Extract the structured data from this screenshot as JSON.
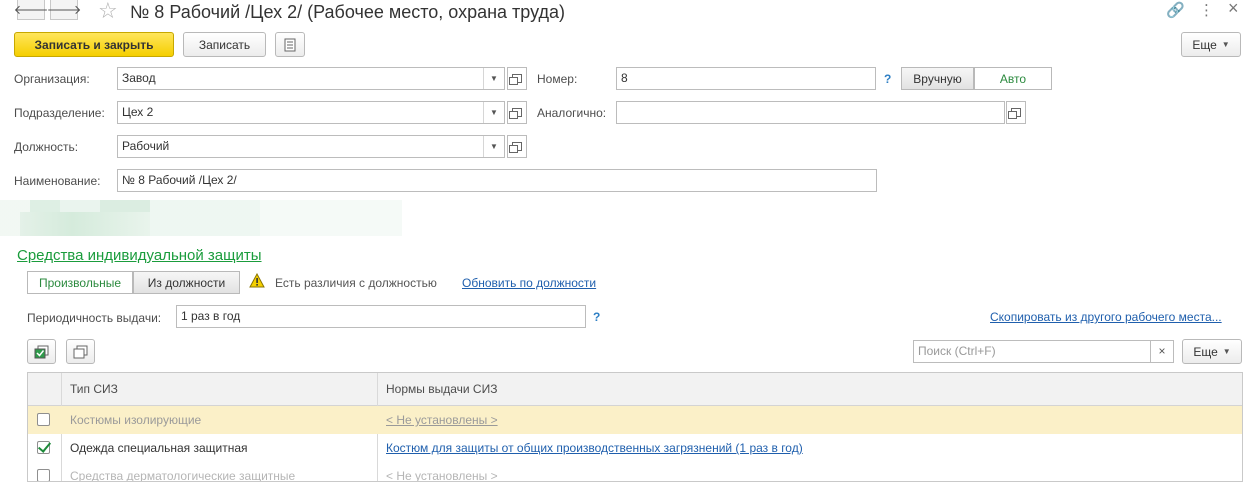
{
  "window": {
    "title": "№ 8 Рабочий /Цех 2/ (Рабочее место, охрана труда)",
    "nav_back": "🡐",
    "nav_forward": "🡒",
    "star": "☆",
    "link_icon": "🔗",
    "more_icon": "⋮",
    "close_icon": "×"
  },
  "toolbar": {
    "save_close_label": "Записать и закрыть",
    "save_label": "Записать",
    "more_label": "Еще"
  },
  "form": {
    "org_label": "Организация:",
    "org_value": "Завод",
    "dept_label": "Подразделение:",
    "dept_value": "Цех 2",
    "position_label": "Должность:",
    "position_value": "Рабочий",
    "name_label": "Наименование:",
    "name_value": "№ 8 Рабочий /Цех 2/",
    "number_label": "Номер:",
    "number_value": "8",
    "help_mark": "?",
    "manual_label": "Вручную",
    "auto_label": "Авто",
    "similar_label": "Аналогично:",
    "similar_value": ""
  },
  "siz": {
    "section_title": "Средства индивидуальной защиты",
    "mode_custom": "Произвольные",
    "mode_position": "Из должности",
    "diff_text": "Есть различия с должностью",
    "update_link": "Обновить по должности",
    "period_label": "Периодичность выдачи:",
    "period_value": "1 раз в год",
    "copy_link": "Скопировать из другого рабочего места...",
    "search_placeholder": "Поиск (Ctrl+F)",
    "clear_icon": "×",
    "more_label": "Еще"
  },
  "table": {
    "col_type": "Тип СИЗ",
    "col_norms": "Нормы выдачи СИЗ",
    "rows": [
      {
        "checked": false,
        "type": "Костюмы изолирующие",
        "norm": "< Не установлены >",
        "selected": true,
        "muted": true
      },
      {
        "checked": true,
        "type": "Одежда специальная защитная",
        "norm": "Костюм для защиты от общих производственных загрязнений (1 раз в год)",
        "selected": false,
        "muted": false
      },
      {
        "checked": false,
        "type": "Средства дерматологические защитные",
        "norm": "< Не установлены >",
        "selected": false,
        "muted": true
      }
    ]
  },
  "colors": {
    "accent_green": "#1a9c3c",
    "link_blue": "#1f5fad",
    "primary_yellow": "#f5cf00",
    "selected_row": "#fbf0c8"
  }
}
